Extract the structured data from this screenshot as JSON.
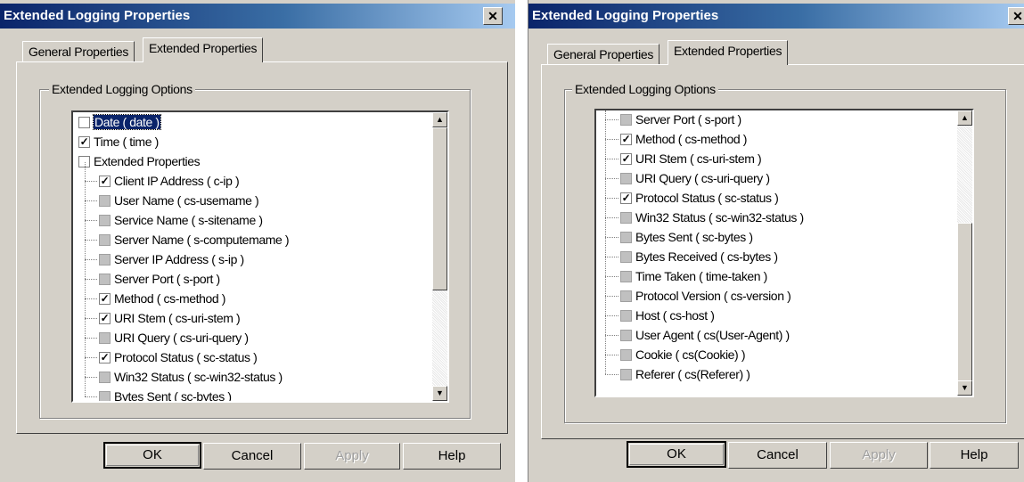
{
  "colors": {
    "title_bar": "#0a246a",
    "face": "#d4d0c8",
    "selection": "#0a246a"
  },
  "dialogs": [
    {
      "title": "Extended Logging Properties",
      "close_icon": "close-icon",
      "tabs": [
        {
          "label": "General Properties"
        },
        {
          "label": "Extended Properties"
        }
      ],
      "group_label": "Extended Logging Options",
      "items": [
        {
          "label": "Date  ( date )",
          "check": "unchecked",
          "selected": true
        },
        {
          "label": "Time  ( time )",
          "check": "checked"
        },
        {
          "label": "Extended Properties",
          "check": "unchecked"
        },
        {
          "label": "Client IP Address  ( c-ip )",
          "check": "checked"
        },
        {
          "label": "User Name  ( cs-usemame )",
          "check": "gray"
        },
        {
          "label": "Service Name  ( s-sitename )",
          "check": "gray"
        },
        {
          "label": "Server Name  ( s-computemame )",
          "check": "gray"
        },
        {
          "label": "Server IP Address  ( s-ip )",
          "check": "gray"
        },
        {
          "label": "Server Port  ( s-port )",
          "check": "gray"
        },
        {
          "label": "Method  ( cs-method )",
          "check": "checked"
        },
        {
          "label": "URI Stem  ( cs-uri-stem )",
          "check": "checked"
        },
        {
          "label": "URI Query  ( cs-uri-query )",
          "check": "gray"
        },
        {
          "label": "Protocol Status  ( sc-status )",
          "check": "checked"
        },
        {
          "label": "Win32 Status  ( sc-win32-status )",
          "check": "gray"
        },
        {
          "label": "Bytes Sent  ( sc-bytes )",
          "check": "gray"
        }
      ],
      "scroll_position": 0,
      "buttons": {
        "ok": "OK",
        "cancel": "Cancel",
        "apply": "Apply",
        "help": "Help"
      }
    },
    {
      "title": "Extended Logging Properties",
      "close_icon": "close-icon",
      "tabs": [
        {
          "label": "General Properties"
        },
        {
          "label": "Extended Properties"
        }
      ],
      "group_label": "Extended Logging Options",
      "items": [
        {
          "label": "Server Port  ( s-port )",
          "check": "gray"
        },
        {
          "label": "Method  ( cs-method )",
          "check": "checked"
        },
        {
          "label": "URI Stem  ( cs-uri-stem )",
          "check": "checked"
        },
        {
          "label": "URI Query  ( cs-uri-query )",
          "check": "gray"
        },
        {
          "label": "Protocol Status  ( sc-status )",
          "check": "checked"
        },
        {
          "label": "Win32 Status  ( sc-win32-status )",
          "check": "gray"
        },
        {
          "label": "Bytes Sent  ( sc-bytes )",
          "check": "gray"
        },
        {
          "label": "Bytes Received  ( cs-bytes )",
          "check": "gray"
        },
        {
          "label": "Time Taken  ( time-taken )",
          "check": "gray"
        },
        {
          "label": "Protocol Version  ( cs-version )",
          "check": "gray"
        },
        {
          "label": "Host  ( cs-host )",
          "check": "gray"
        },
        {
          "label": "User Agent  ( cs(User-Agent) )",
          "check": "gray"
        },
        {
          "label": "Cookie  ( cs(Cookie) )",
          "check": "gray"
        },
        {
          "label": "Referer  ( cs(Referer) )",
          "check": "gray"
        }
      ],
      "scroll_position": 1,
      "buttons": {
        "ok": "OK",
        "cancel": "Cancel",
        "apply": "Apply",
        "help": "Help"
      }
    }
  ]
}
